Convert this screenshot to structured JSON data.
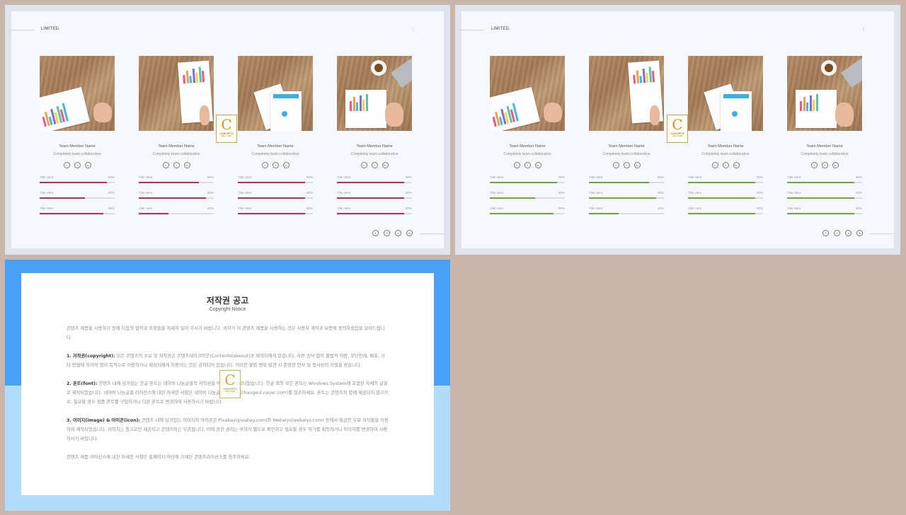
{
  "slides": [
    {
      "brand": "LIMITED.",
      "dots": "⁝",
      "accent": "#c4285c",
      "members": [
        {
          "name": "Team  Member  Name",
          "role": "Completely  team  collaborative",
          "skills": [
            {
              "title": "Title  Here",
              "pct": "90%",
              "value": 0.9
            },
            {
              "title": "Title  Here",
              "pct": "60%",
              "value": 0.6
            },
            {
              "title": "Title  Here",
              "pct": "85%",
              "value": 0.85
            }
          ]
        },
        {
          "name": "Team  Member  Name",
          "role": "Completely  team  collaborative",
          "skills": [
            {
              "title": "Title  Here",
              "pct": "80%",
              "value": 0.8
            },
            {
              "title": "Title  Here",
              "pct": "90%",
              "value": 0.9
            },
            {
              "title": "Title  Here",
              "pct": "40%",
              "value": 0.4
            }
          ]
        },
        {
          "name": "Team  Member  Name",
          "role": "Completely  team  collaborative",
          "skills": [
            {
              "title": "Title  Here",
              "pct": "90%",
              "value": 0.9
            },
            {
              "title": "Title  Here",
              "pct": "90%",
              "value": 0.9
            },
            {
              "title": "Title  Here",
              "pct": "90%",
              "value": 0.9
            }
          ]
        },
        {
          "name": "Team  Member  Name",
          "role": "Completely  team  collaborative",
          "skills": [
            {
              "title": "Title  Here",
              "pct": "90%",
              "value": 0.9
            },
            {
              "title": "Title  Here",
              "pct": "90%",
              "value": 0.9
            },
            {
              "title": "Title  Here",
              "pct": "90%",
              "value": 0.9
            }
          ]
        }
      ]
    },
    {
      "brand": "LIMITED.",
      "dots": "⁝",
      "accent": "#6aaa3a",
      "members": [
        {
          "name": "Team  Member  Name",
          "role": "Completely  team  collaborative",
          "skills": [
            {
              "title": "Title  Here",
              "pct": "90%",
              "value": 0.9
            },
            {
              "title": "Title  Here",
              "pct": "60%",
              "value": 0.6
            },
            {
              "title": "Title  Here",
              "pct": "85%",
              "value": 0.85
            }
          ]
        },
        {
          "name": "Team  Member  Name",
          "role": "Completely  team  collaborative",
          "skills": [
            {
              "title": "Title  Here",
              "pct": "80%",
              "value": 0.8
            },
            {
              "title": "Title  Here",
              "pct": "90%",
              "value": 0.9
            },
            {
              "title": "Title  Here",
              "pct": "40%",
              "value": 0.4
            }
          ]
        },
        {
          "name": "Team  Member  Name",
          "role": "Completely  team  collaborative",
          "skills": [
            {
              "title": "Title  Here",
              "pct": "90%",
              "value": 0.9
            },
            {
              "title": "Title  Here",
              "pct": "90%",
              "value": 0.9
            },
            {
              "title": "Title  Here",
              "pct": "90%",
              "value": 0.9
            }
          ]
        },
        {
          "name": "Team  Member  Name",
          "role": "Completely  team  collaborative",
          "skills": [
            {
              "title": "Title  Here",
              "pct": "90%",
              "value": 0.9
            },
            {
              "title": "Title  Here",
              "pct": "90%",
              "value": 0.9
            },
            {
              "title": "Title  Here",
              "pct": "90%",
              "value": 0.9
            }
          ]
        }
      ]
    }
  ],
  "social_icons": [
    "twitter-icon",
    "facebook-icon",
    "linkedin-icon"
  ],
  "footer_icons": [
    "facebook-icon",
    "twitter-icon",
    "vimeo-icon",
    "linkedin-icon"
  ],
  "logo": {
    "letter": "C",
    "line1": "CONCEPTS",
    "line2": "REAL CORP"
  },
  "notice": {
    "title": "저작권 공고",
    "subtitle": "Copyright Notice",
    "intro": "콘텐츠 제품을 사용하기 전에 다음의 협약과 조항들을 자세히 읽어 주시기 바랍니다. 귀하가 이 콘텐츠 제품을 사용하는 것은 사용자 계약과 보증에 동의하셨음을 알려드립니다.",
    "s1_head": "1. 저작권(copyright):",
    "s1_body": " 모든 콘텐츠의 소유 및 저작권은 콘텐츠테이크아웃(Contentstakeout)과 제작자에게 있습니다. 사전 승낙 없이 불법적 이용, 무단전재, 배포, 기타 방법에 의하여 영리 목적으로 이용하거나 제삼자에게 이용하는 것은 금지되어 있습니다. 이러한 불법 행위 발견 시 준엄한 민사 및 형사상의 처벌을 받습니다.",
    "s2_head": "2. 폰트(font):",
    "s2_body": " 콘텐츠 내에 담겨있는 한글 폰트는 네이버 나눔글꼴의 저작권을 허용하여 제작되었습니다. 한글 외의 모든 폰트는 Windows System에 포함된 자체의 글꼴로 제작되었습니다. 네이버 나눔글꼴 라이선스에 대한 자세한 사항은 네이버 나눔글꼴 홈페이지(hangeul.naver.com)를 참조하세요. 폰트는 콘텐츠와 함께 제공되지 않으므로, 필요할 경우 정품 폰트를 구입하거나 다른 폰트로 변경하여 사용하시기 바랍니다.",
    "s3_head": "3. 이미지(image) & 아이콘(icon):",
    "s3_body": " 콘텐츠 내에 담겨있는 이미지와 아이콘은 Pixabay(pixabay.com)와 Webalys(webalys.com) 등에서 제공한 무료 저작물을 이용하여 제작되었습니다. 이미지는 참고로만 제공되고 콘텐츠와는 무관합니다. 이에 관한 권리는 귀하가 별도로 확인하고 필요할 경우 허가를 취득하거나 이미지를 변경하여 사용하시기 바랍니다.",
    "outro": "콘텐츠 제품 라이선스에 대한 자세한 사항은 홈페이지 하단에 기재된 콘텐츠라이선스를 참조하세요."
  }
}
